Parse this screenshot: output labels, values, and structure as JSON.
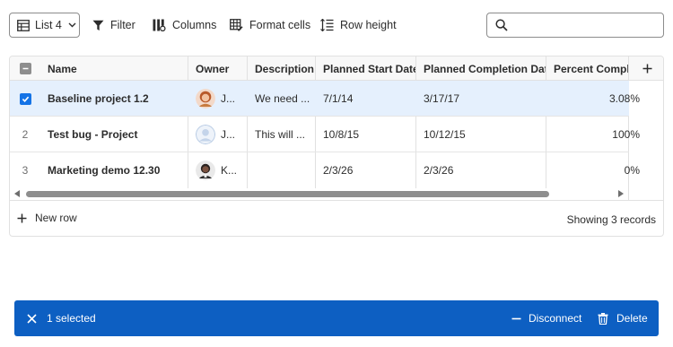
{
  "toolbar": {
    "list_label": "List 4",
    "filter_label": "Filter",
    "columns_label": "Columns",
    "format_label": "Format cells",
    "row_height_label": "Row height",
    "search_placeholder": ""
  },
  "grid": {
    "columns": [
      "Name",
      "Owner",
      "Description",
      "Planned Start Date",
      "Planned Completion Date",
      "Percent Complet"
    ],
    "rows": [
      {
        "num": "",
        "selected": true,
        "name": "Baseline project 1.2",
        "owner": "J...",
        "description": "We need ...",
        "start": "7/1/14",
        "completion": "3/17/17",
        "percent": "3.08%"
      },
      {
        "num": "2",
        "selected": false,
        "name": "Test bug - Project",
        "owner": "J...",
        "description": "This will ...",
        "start": "10/8/15",
        "completion": "10/12/15",
        "percent": "100%"
      },
      {
        "num": "3",
        "selected": false,
        "name": "Marketing demo 12.30",
        "owner": "K...",
        "description": "",
        "start": "2/3/26",
        "completion": "2/3/26",
        "percent": "0%"
      }
    ],
    "new_row_label": "New row",
    "records_label": "Showing 3 records"
  },
  "actionbar": {
    "selected_label": "1 selected",
    "disconnect_label": "Disconnect",
    "delete_label": "Delete"
  },
  "colors": {
    "accent": "#1473e6",
    "selected_row": "#e5f0fd",
    "action_bar": "#0d5fc2"
  }
}
